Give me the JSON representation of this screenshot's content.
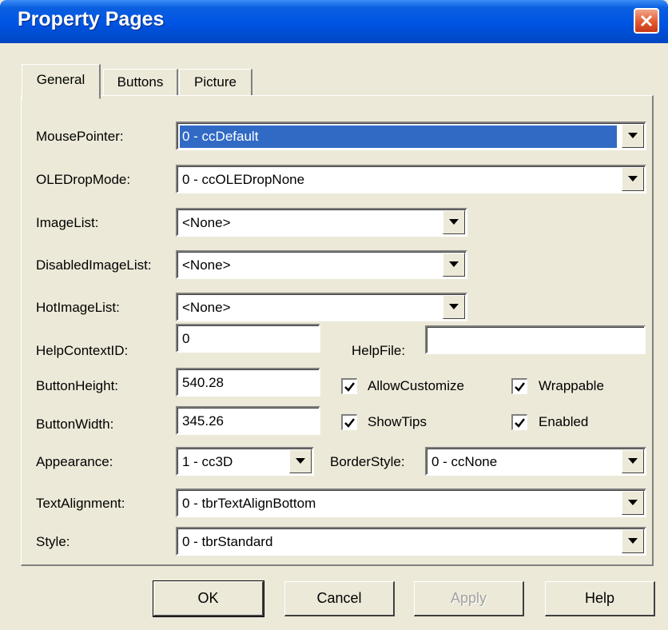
{
  "window": {
    "title": "Property Pages"
  },
  "tabs": [
    "General",
    "Buttons",
    "Picture"
  ],
  "fields": {
    "mouse_pointer": {
      "label": "MousePointer:",
      "value": "0 - ccDefault"
    },
    "ole_drop_mode": {
      "label": "OLEDropMode:",
      "value": "0 - ccOLEDropNone"
    },
    "image_list": {
      "label": "ImageList:",
      "value": "<None>"
    },
    "disabled_image_list": {
      "label": "DisabledImageList:",
      "value": "<None>"
    },
    "hot_image_list": {
      "label": "HotImageList:",
      "value": "<None>"
    },
    "help_context_id": {
      "label": "HelpContextID:",
      "value": "0"
    },
    "help_file": {
      "label": "HelpFile:",
      "value": ""
    },
    "button_height": {
      "label": "ButtonHeight:",
      "value": "540.28"
    },
    "button_width": {
      "label": "ButtonWidth:",
      "value": "345.26"
    },
    "appearance": {
      "label": "Appearance:",
      "value": "1 - cc3D"
    },
    "border_style": {
      "label": "BorderStyle:",
      "value": "0 - ccNone"
    },
    "text_alignment": {
      "label": "TextAlignment:",
      "value": "0 - tbrTextAlignBottom"
    },
    "style": {
      "label": "Style:",
      "value": "0 - tbrStandard"
    }
  },
  "checkboxes": {
    "allow_customize": {
      "label": "AllowCustomize",
      "checked": true
    },
    "wrappable": {
      "label": "Wrappable",
      "checked": true
    },
    "show_tips": {
      "label": "ShowTips",
      "checked": true
    },
    "enabled": {
      "label": "Enabled",
      "checked": true
    }
  },
  "buttons": {
    "ok": "OK",
    "cancel": "Cancel",
    "apply": "Apply",
    "help": "Help"
  }
}
